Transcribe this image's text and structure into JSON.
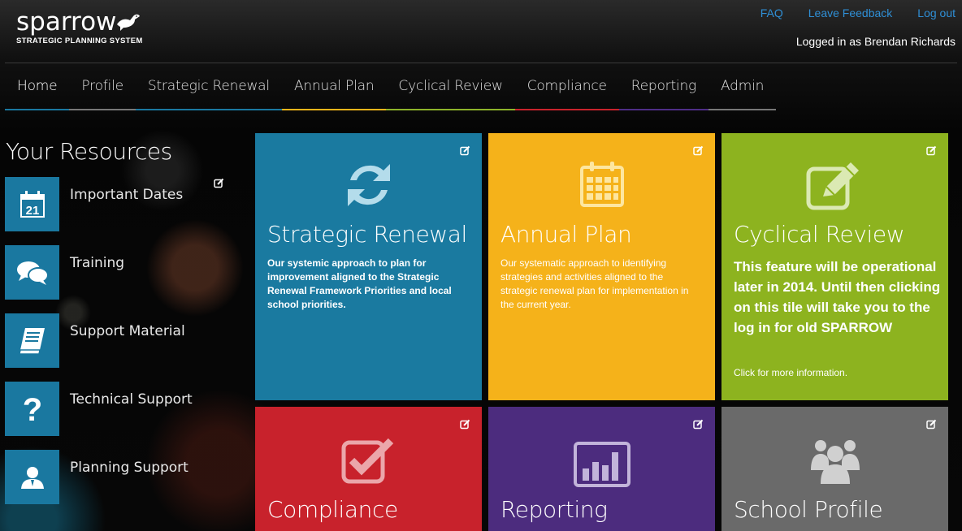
{
  "app": {
    "logo_text": "sparrow",
    "logo_subtitle": "STRATEGIC PLANNING SYSTEM"
  },
  "top_links": {
    "faq": "FAQ",
    "feedback": "Leave Feedback",
    "logout": "Log out"
  },
  "user": {
    "logged_in_text": "Logged in as Brendan Richards"
  },
  "nav": [
    {
      "label": "Home",
      "color": "#1a78a0"
    },
    {
      "label": "Profile",
      "color": "#777777"
    },
    {
      "label": "Strategic Renewal",
      "color": "#1a78a0"
    },
    {
      "label": "Annual Plan",
      "color": "#f4b41a"
    },
    {
      "label": "Cyclical Review",
      "color": "#8db32a"
    },
    {
      "label": "Compliance",
      "color": "#c8232c"
    },
    {
      "label": "Reporting",
      "color": "#4e2e86"
    },
    {
      "label": "Admin",
      "color": "#777777"
    }
  ],
  "resources": {
    "title": "Your Resources",
    "items": [
      {
        "label": "Important Dates",
        "icon": "calendar-icon",
        "calendar_day": "21"
      },
      {
        "label": "Training",
        "icon": "chat-bubbles-icon"
      },
      {
        "label": "Support Material",
        "icon": "book-icon"
      },
      {
        "label": "Technical Support",
        "icon": "question-mark-icon"
      },
      {
        "label": "Planning Support",
        "icon": "person-icon"
      }
    ]
  },
  "tiles": {
    "strategic": {
      "title": "Strategic Renewal",
      "description": "Our systemic approach to plan for improvement aligned to the Strategic Renewal Framework Priorities and local school priorities.",
      "color": "#1a7aa0",
      "icon": "refresh-icon"
    },
    "annual": {
      "title": "Annual Plan",
      "description": "Our systematic approach to identifying strategies and activities aligned to the strategic renewal plan for implementation in the current year.",
      "color": "#f5b21a",
      "icon": "calendar-grid-icon"
    },
    "cyclical": {
      "title": "Cyclical Review",
      "notice": "This feature will be operational later in 2014. Until then clicking on this tile will take you to the log in for old SPARROW",
      "more": "Click for more information.",
      "color": "#8db31f",
      "icon": "pencil-square-icon"
    },
    "compliance": {
      "title": "Compliance",
      "color": "#c8222c",
      "icon": "checkbox-icon"
    },
    "reporting": {
      "title": "Reporting",
      "color": "#4c2c7e",
      "icon": "bar-chart-icon"
    },
    "school": {
      "title": "School Profile",
      "color": "#6a6a6a",
      "icon": "group-icon"
    }
  }
}
